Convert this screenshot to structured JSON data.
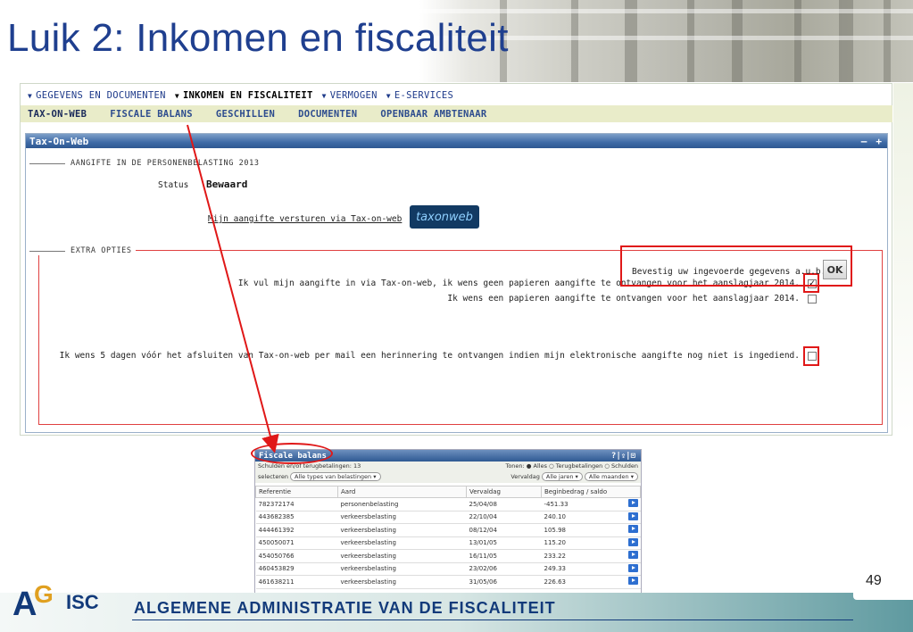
{
  "slide": {
    "title": "Luik 2: Inkomen en fiscaliteit",
    "page_number": "49",
    "footer_text": "ALGEMENE ADMINISTRATIE VAN DE FISCALITEIT",
    "logo_text": "AGI ISC"
  },
  "topnav": {
    "items": [
      {
        "label": "GEGEVENS EN DOCUMENTEN"
      },
      {
        "label": "INKOMEN EN FISCALITEIT"
      },
      {
        "label": "VERMOGEN"
      },
      {
        "label": "E-SERVICES"
      }
    ]
  },
  "subnav": {
    "items": [
      {
        "label": "TAX-ON-WEB"
      },
      {
        "label": "FISCALE BALANS"
      },
      {
        "label": "GESCHILLEN"
      },
      {
        "label": "DOCUMENTEN"
      },
      {
        "label": "OPENBAAR AMBTENAAR"
      }
    ]
  },
  "panel": {
    "title": "Tax-On-Web",
    "ctrl_minus": "–",
    "ctrl_plus": "+",
    "section1_legend": "AANGIFTE IN DE PERSONENBELASTING 2013",
    "status_label": "Status",
    "status_value": "Bewaard",
    "send_link": "Mijn aangifte versturen via Tax-on-web",
    "logo_label": "taxonweb",
    "section2_legend": "EXTRA OPTIES",
    "option1": "Ik vul mijn aangifte in via Tax-on-web, ik wens geen papieren aangifte te ontvangen voor het aanslagjaar 2014.",
    "option2": "Ik wens een papieren aangifte te ontvangen voor het aanslagjaar 2014.",
    "option3": "Ik wens 5 dagen vóór het afsluiten van Tax-on-web per mail een herinnering te ontvangen indien mijn elektronische aangifte nog niet is ingediend.",
    "check_mark": "✓",
    "confirm_text": "Bevestig uw ingevoerde gegevens a.u.b..",
    "ok_label": "OK"
  },
  "fiscale_balans": {
    "title": "Fiscale balans",
    "controls": "?|⇪|⊡",
    "row1_left": "Schulden en/of terugbetalingen: 13",
    "row1_right": "Tonen: ● Alles ○ Terugbetalingen ○ Schulden",
    "select_label": "selecteren",
    "select_value": "Alle types van belastingen ▾",
    "vervaldag_label": "Vervaldag",
    "select_jaren": "Alle jaren ▾",
    "select_maanden": "Alle maanden ▾",
    "columns": [
      "Referentie",
      "Aard",
      "Vervaldag",
      "Beginbedrag / saldo"
    ],
    "rows": [
      [
        "782372174",
        "personenbelasting",
        "25/04/08",
        "-451.33"
      ],
      [
        "443682385",
        "verkeersbelasting",
        "22/10/04",
        "240.10"
      ],
      [
        "444461392",
        "verkeersbelasting",
        "08/12/04",
        "105.98"
      ],
      [
        "450050071",
        "verkeersbelasting",
        "13/01/05",
        "115.20"
      ],
      [
        "454050766",
        "verkeersbelasting",
        "16/11/05",
        "233.22"
      ],
      [
        "460453829",
        "verkeersbelasting",
        "23/02/06",
        "249.33"
      ],
      [
        "461638211",
        "verkeersbelasting",
        "31/05/06",
        "226.63"
      ]
    ]
  }
}
